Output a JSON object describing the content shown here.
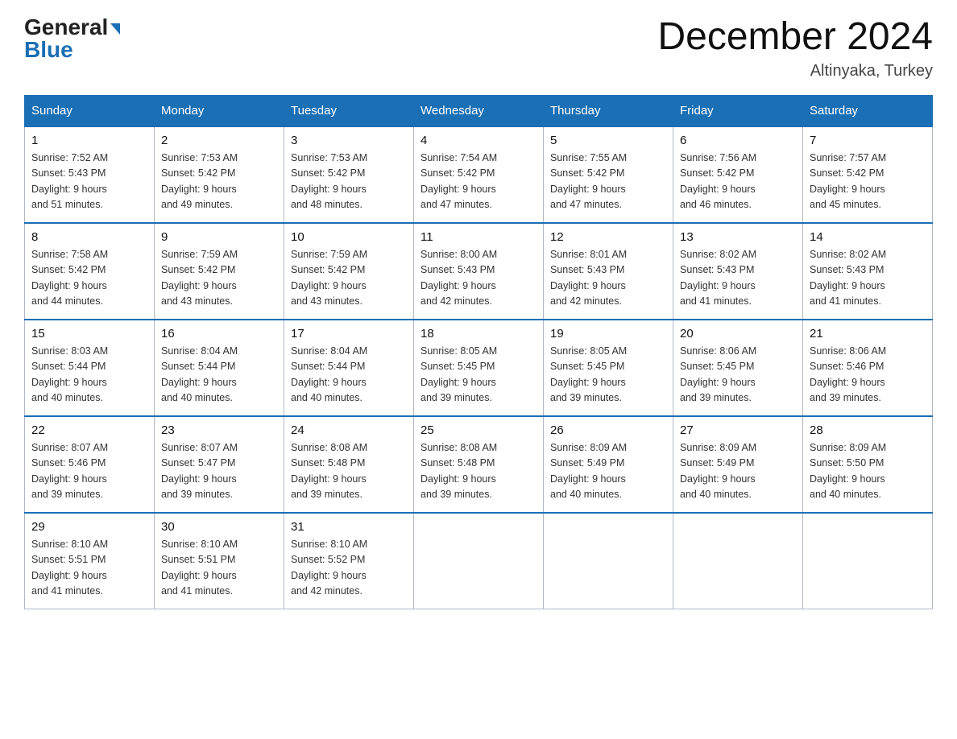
{
  "logo": {
    "general": "General",
    "blue": "Blue",
    "arrow": "▶"
  },
  "header": {
    "title": "December 2024",
    "subtitle": "Altinyaka, Turkey"
  },
  "weekdays": [
    "Sunday",
    "Monday",
    "Tuesday",
    "Wednesday",
    "Thursday",
    "Friday",
    "Saturday"
  ],
  "weeks": [
    [
      {
        "day": "1",
        "info": "Sunrise: 7:52 AM\nSunset: 5:43 PM\nDaylight: 9 hours\nand 51 minutes."
      },
      {
        "day": "2",
        "info": "Sunrise: 7:53 AM\nSunset: 5:42 PM\nDaylight: 9 hours\nand 49 minutes."
      },
      {
        "day": "3",
        "info": "Sunrise: 7:53 AM\nSunset: 5:42 PM\nDaylight: 9 hours\nand 48 minutes."
      },
      {
        "day": "4",
        "info": "Sunrise: 7:54 AM\nSunset: 5:42 PM\nDaylight: 9 hours\nand 47 minutes."
      },
      {
        "day": "5",
        "info": "Sunrise: 7:55 AM\nSunset: 5:42 PM\nDaylight: 9 hours\nand 47 minutes."
      },
      {
        "day": "6",
        "info": "Sunrise: 7:56 AM\nSunset: 5:42 PM\nDaylight: 9 hours\nand 46 minutes."
      },
      {
        "day": "7",
        "info": "Sunrise: 7:57 AM\nSunset: 5:42 PM\nDaylight: 9 hours\nand 45 minutes."
      }
    ],
    [
      {
        "day": "8",
        "info": "Sunrise: 7:58 AM\nSunset: 5:42 PM\nDaylight: 9 hours\nand 44 minutes."
      },
      {
        "day": "9",
        "info": "Sunrise: 7:59 AM\nSunset: 5:42 PM\nDaylight: 9 hours\nand 43 minutes."
      },
      {
        "day": "10",
        "info": "Sunrise: 7:59 AM\nSunset: 5:42 PM\nDaylight: 9 hours\nand 43 minutes."
      },
      {
        "day": "11",
        "info": "Sunrise: 8:00 AM\nSunset: 5:43 PM\nDaylight: 9 hours\nand 42 minutes."
      },
      {
        "day": "12",
        "info": "Sunrise: 8:01 AM\nSunset: 5:43 PM\nDaylight: 9 hours\nand 42 minutes."
      },
      {
        "day": "13",
        "info": "Sunrise: 8:02 AM\nSunset: 5:43 PM\nDaylight: 9 hours\nand 41 minutes."
      },
      {
        "day": "14",
        "info": "Sunrise: 8:02 AM\nSunset: 5:43 PM\nDaylight: 9 hours\nand 41 minutes."
      }
    ],
    [
      {
        "day": "15",
        "info": "Sunrise: 8:03 AM\nSunset: 5:44 PM\nDaylight: 9 hours\nand 40 minutes."
      },
      {
        "day": "16",
        "info": "Sunrise: 8:04 AM\nSunset: 5:44 PM\nDaylight: 9 hours\nand 40 minutes."
      },
      {
        "day": "17",
        "info": "Sunrise: 8:04 AM\nSunset: 5:44 PM\nDaylight: 9 hours\nand 40 minutes."
      },
      {
        "day": "18",
        "info": "Sunrise: 8:05 AM\nSunset: 5:45 PM\nDaylight: 9 hours\nand 39 minutes."
      },
      {
        "day": "19",
        "info": "Sunrise: 8:05 AM\nSunset: 5:45 PM\nDaylight: 9 hours\nand 39 minutes."
      },
      {
        "day": "20",
        "info": "Sunrise: 8:06 AM\nSunset: 5:45 PM\nDaylight: 9 hours\nand 39 minutes."
      },
      {
        "day": "21",
        "info": "Sunrise: 8:06 AM\nSunset: 5:46 PM\nDaylight: 9 hours\nand 39 minutes."
      }
    ],
    [
      {
        "day": "22",
        "info": "Sunrise: 8:07 AM\nSunset: 5:46 PM\nDaylight: 9 hours\nand 39 minutes."
      },
      {
        "day": "23",
        "info": "Sunrise: 8:07 AM\nSunset: 5:47 PM\nDaylight: 9 hours\nand 39 minutes."
      },
      {
        "day": "24",
        "info": "Sunrise: 8:08 AM\nSunset: 5:48 PM\nDaylight: 9 hours\nand 39 minutes."
      },
      {
        "day": "25",
        "info": "Sunrise: 8:08 AM\nSunset: 5:48 PM\nDaylight: 9 hours\nand 39 minutes."
      },
      {
        "day": "26",
        "info": "Sunrise: 8:09 AM\nSunset: 5:49 PM\nDaylight: 9 hours\nand 40 minutes."
      },
      {
        "day": "27",
        "info": "Sunrise: 8:09 AM\nSunset: 5:49 PM\nDaylight: 9 hours\nand 40 minutes."
      },
      {
        "day": "28",
        "info": "Sunrise: 8:09 AM\nSunset: 5:50 PM\nDaylight: 9 hours\nand 40 minutes."
      }
    ],
    [
      {
        "day": "29",
        "info": "Sunrise: 8:10 AM\nSunset: 5:51 PM\nDaylight: 9 hours\nand 41 minutes."
      },
      {
        "day": "30",
        "info": "Sunrise: 8:10 AM\nSunset: 5:51 PM\nDaylight: 9 hours\nand 41 minutes."
      },
      {
        "day": "31",
        "info": "Sunrise: 8:10 AM\nSunset: 5:52 PM\nDaylight: 9 hours\nand 42 minutes."
      },
      null,
      null,
      null,
      null
    ]
  ]
}
